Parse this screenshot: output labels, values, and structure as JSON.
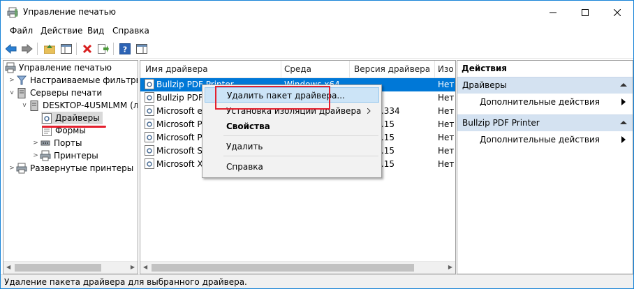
{
  "window": {
    "title": "Управление печатью"
  },
  "menu": [
    "Файл",
    "Действие",
    "Вид",
    "Справка"
  ],
  "tree": {
    "root": "Управление печатью",
    "filters": "Настраиваемые фильтры",
    "servers": "Серверы печати",
    "server": "DESKTOP-4U5MLMM (л",
    "drivers": "Драйверы",
    "forms": "Формы",
    "ports": "Порты",
    "printers": "Принтеры",
    "deployed": "Развернутые принтеры"
  },
  "list": {
    "columns": [
      "Имя драйвера",
      "Среда",
      "Версия драйвера",
      "Изо"
    ],
    "rows": [
      {
        "name": "Bullzip PDF Printer",
        "env": "Windows x64",
        "ver": "",
        "iso": "Нет"
      },
      {
        "name": "Bullzip PDF P",
        "env": "",
        "ver": "",
        "iso": "Нет"
      },
      {
        "name": "Microsoft en",
        "env": "",
        "ver": "299.334",
        "iso": "Нет"
      },
      {
        "name": "Microsoft Pr",
        "env": "",
        "ver": "299.15",
        "iso": "Нет"
      },
      {
        "name": "Microsoft PS",
        "env": "",
        "ver": "299.15",
        "iso": "Нет"
      },
      {
        "name": "Microsoft Sh",
        "env": "",
        "ver": "299.15",
        "iso": "Нет"
      },
      {
        "name": "Microsoft XP",
        "env": "",
        "ver": "299.15",
        "iso": "Нет"
      }
    ]
  },
  "actions": {
    "title": "Действия",
    "section1": "Драйверы",
    "section1_more": "Дополнительные действия",
    "section2": "Bullzip PDF Printer",
    "section2_more": "Дополнительные действия"
  },
  "context_menu": {
    "remove_package": "Удалить пакет драйвера...",
    "isolation": "Установка изоляции драйвера",
    "properties": "Свойства",
    "delete": "Удалить",
    "help": "Справка"
  },
  "status": "Удаление пакета драйвера для выбранного драйвера.",
  "colors": {
    "accent": "#0078d7",
    "highlight": "#e4202e",
    "section": "#d4e2f1"
  }
}
